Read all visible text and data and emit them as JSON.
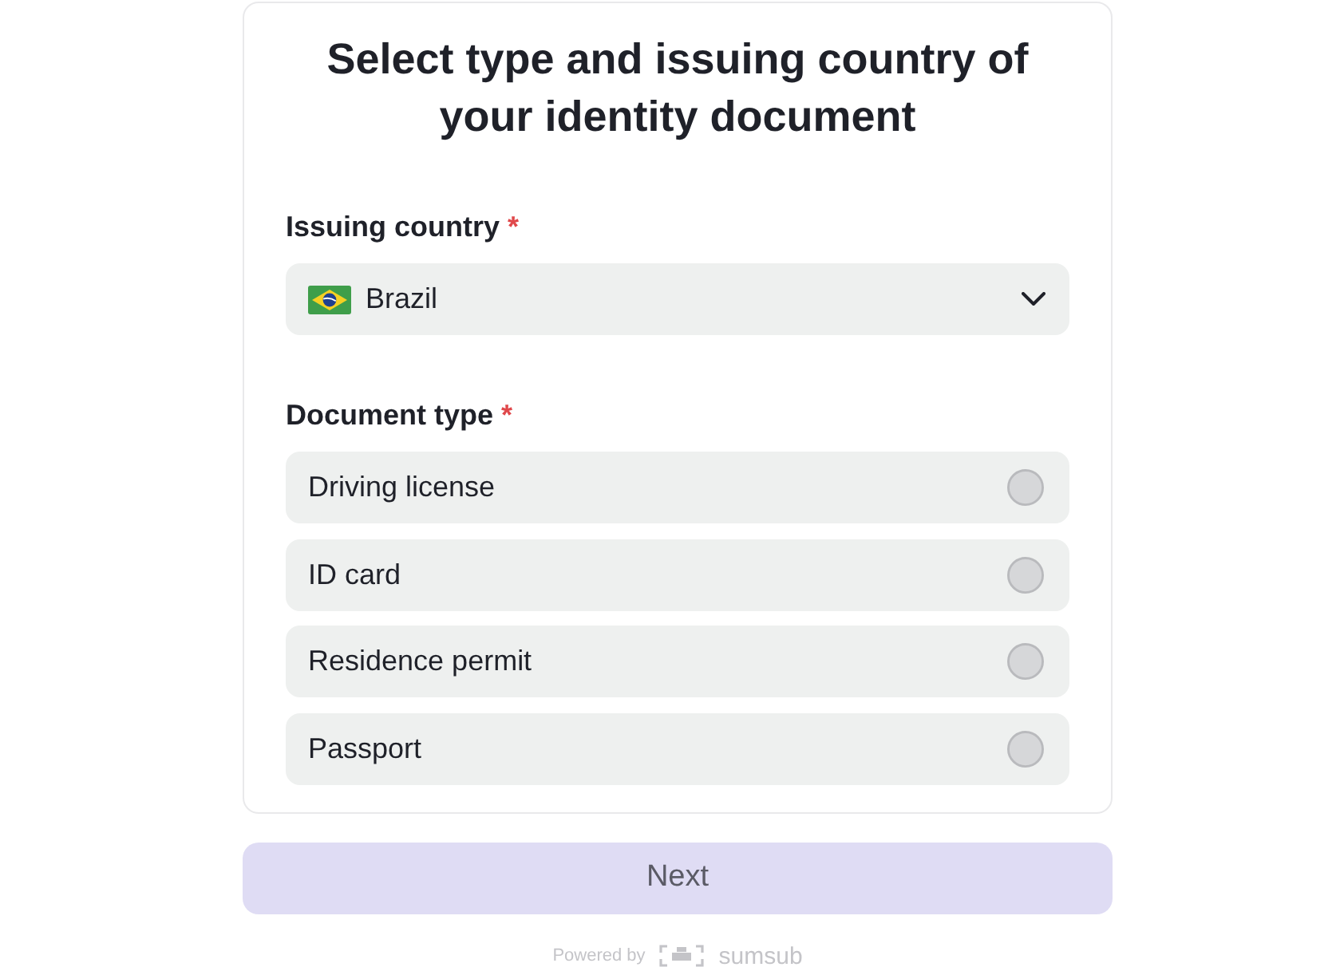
{
  "title": "Select type and issuing country of your identity document",
  "country_field": {
    "label": "Issuing country",
    "required_mark": "*",
    "value": "Brazil"
  },
  "document_type": {
    "label": "Document type",
    "required_mark": "*",
    "options": [
      {
        "label": "Driving license",
        "selected": false
      },
      {
        "label": "ID card",
        "selected": false
      },
      {
        "label": "Residence permit",
        "selected": false
      },
      {
        "label": "Passport",
        "selected": false
      }
    ]
  },
  "next_button": {
    "label": "Next",
    "disabled": true
  },
  "footer": {
    "powered_by": "Powered by",
    "brand": "sumsub"
  }
}
